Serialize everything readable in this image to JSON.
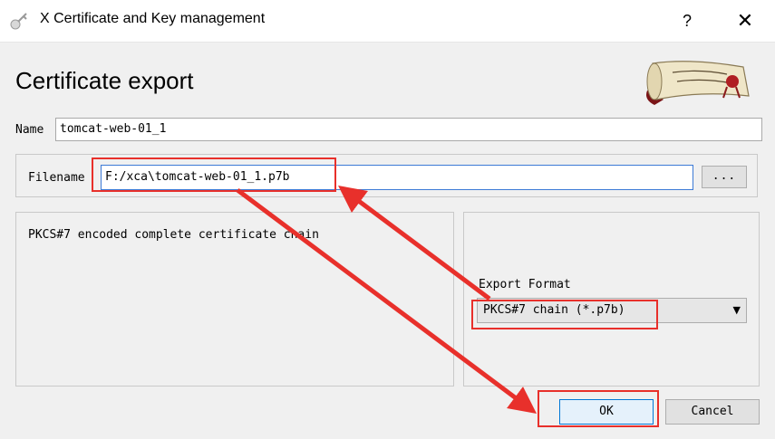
{
  "window": {
    "title": "X Certificate and Key management",
    "help_label": "?",
    "close_label": "✕",
    "app_icon": "certificate-icon"
  },
  "dialog": {
    "heading": "Certificate export",
    "logo": "scroll-logo"
  },
  "name_field": {
    "label": "Name",
    "value": "tomcat-web-01_1"
  },
  "filename_field": {
    "label": "Filename",
    "value": "F:/xca\\tomcat-web-01_1.p7b",
    "browse_label": "..."
  },
  "description": {
    "text": "PKCS#7 encoded complete certificate chain"
  },
  "export_format": {
    "label": "Export Format",
    "selected": "PKCS#7 chain (*.p7b)"
  },
  "buttons": {
    "ok": "OK",
    "cancel": "Cancel"
  },
  "annotation_color": "#e8302b"
}
